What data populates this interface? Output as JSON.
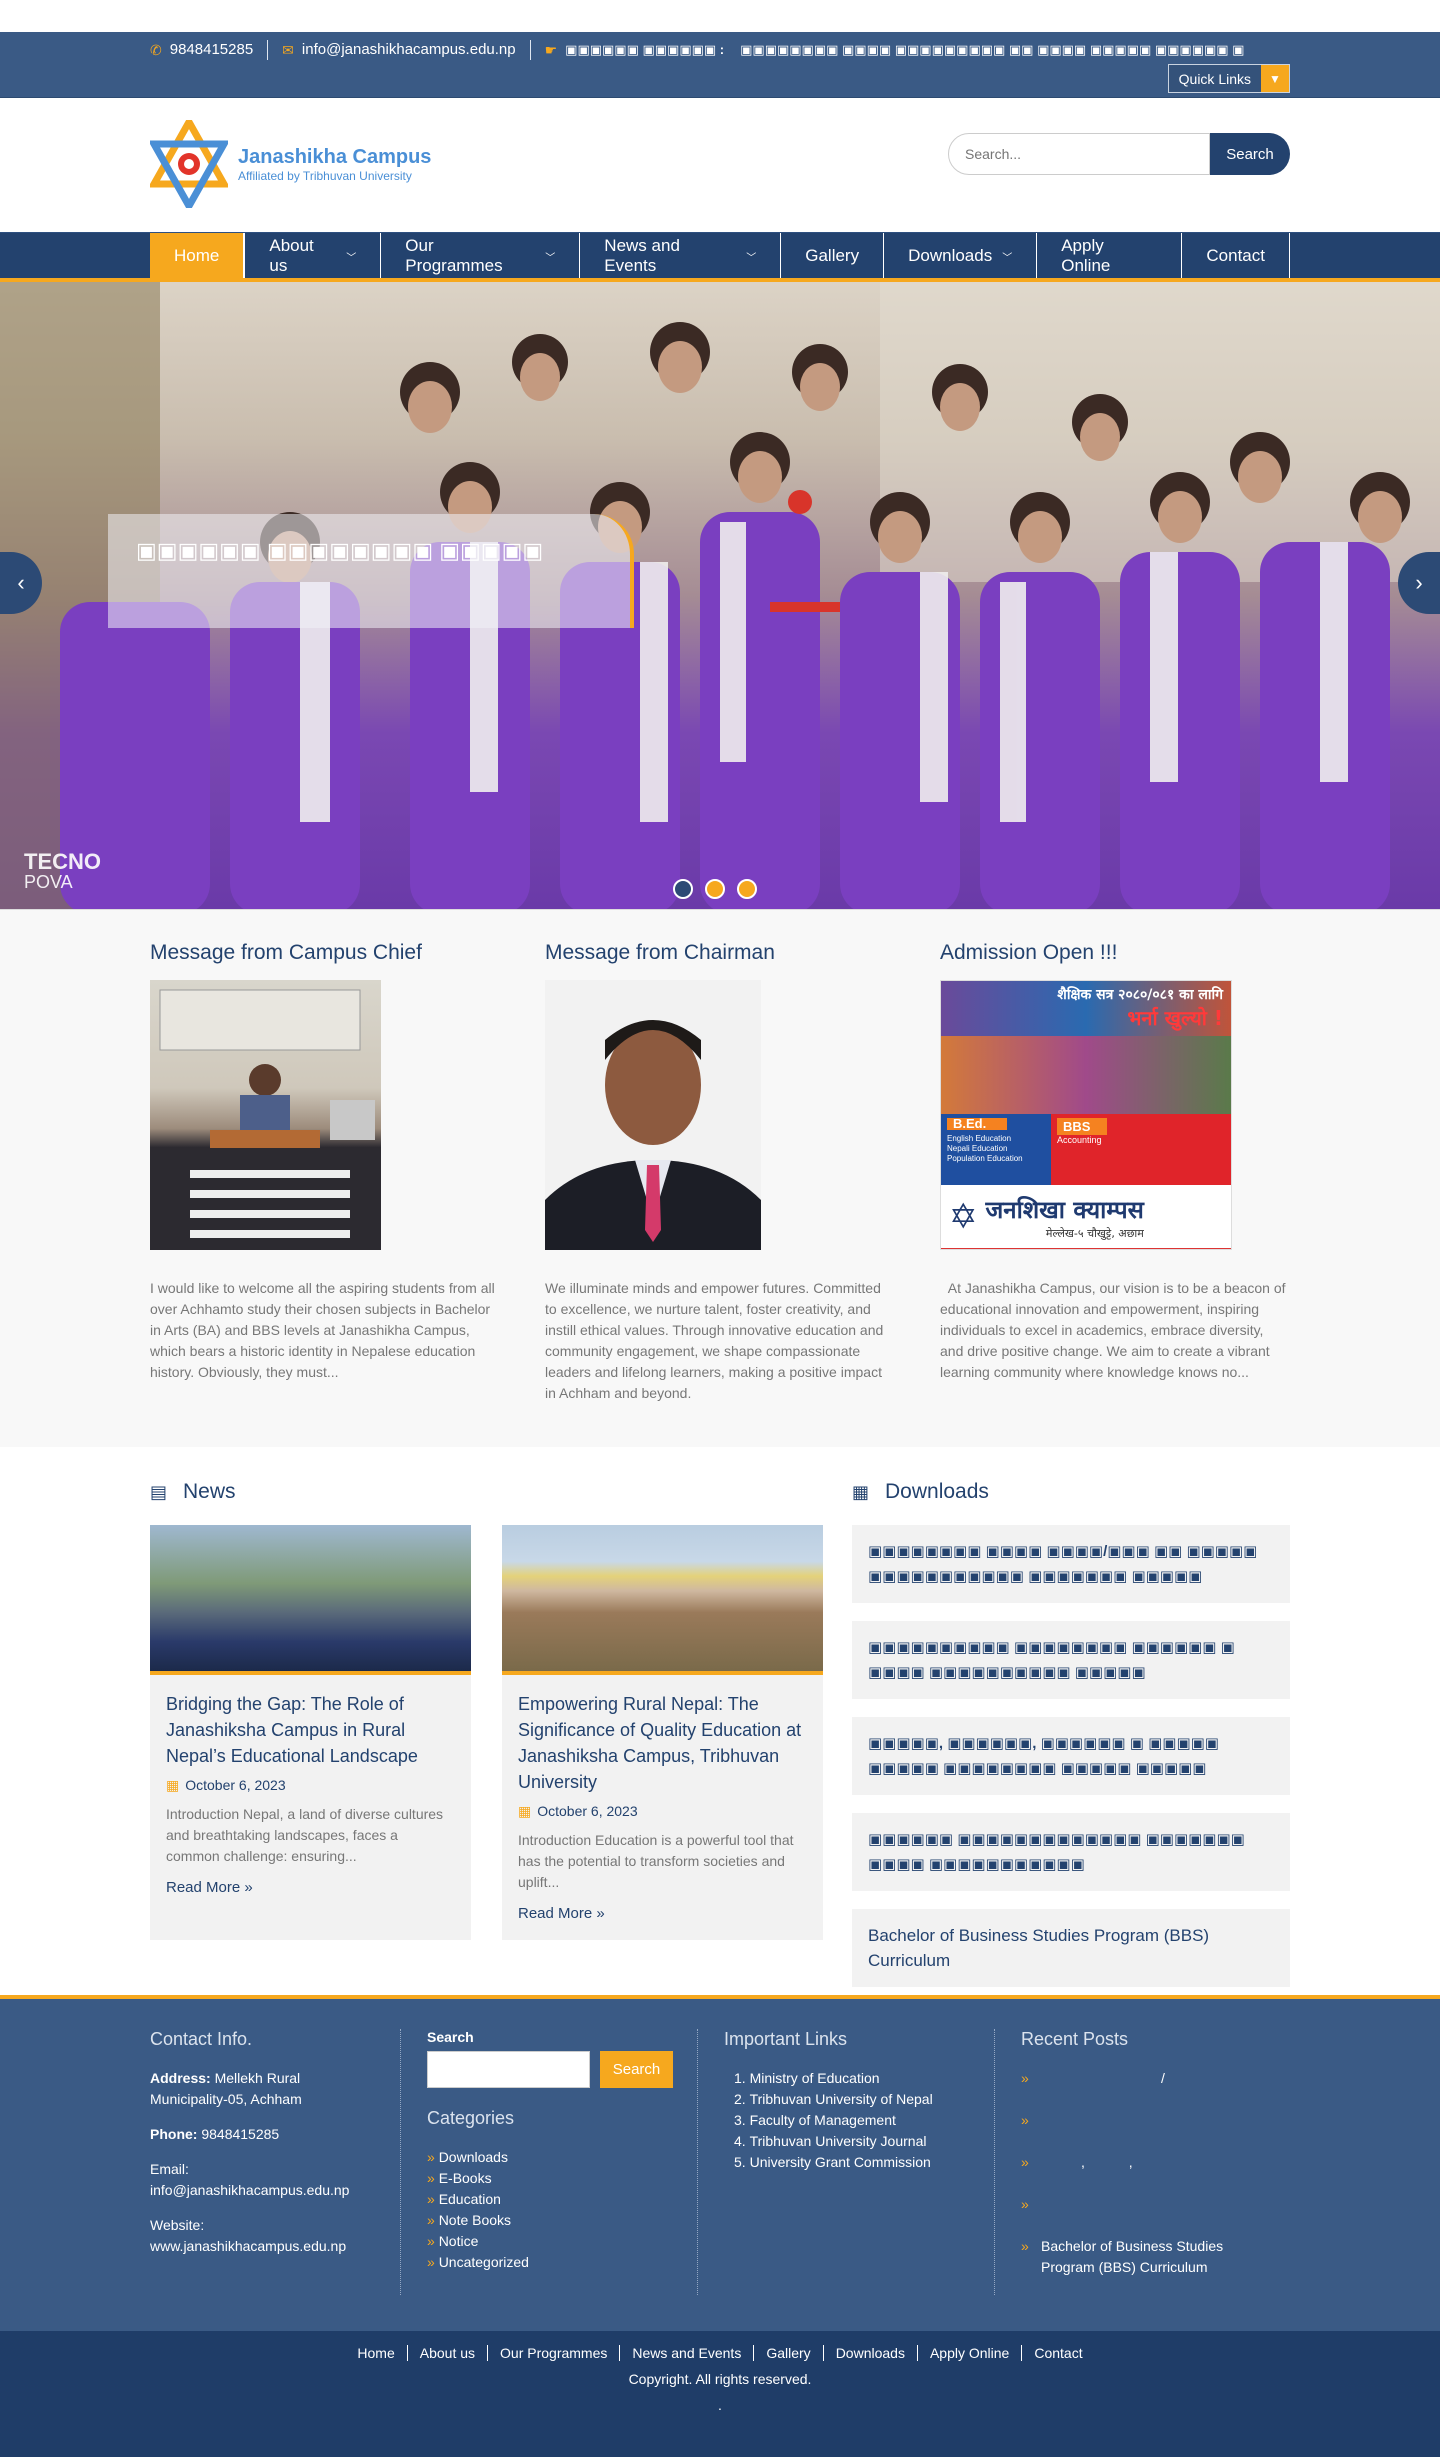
{
  "topbar": {
    "phone": "9848415285",
    "email": "info@janashikhacampus.edu.np",
    "notice_label": "▣▣▣▣▣▣ ▣▣▣▣▣▣ :",
    "notice_text": "▣▣▣▣▣▣▣▣ ▣▣▣▣ ▣▣▣▣▣▣▣▣▣ ▣▣ ▣▣▣▣ ▣▣▣▣▣ ▣▣▣▣▣▣ ▣",
    "quick_links": "Quick Links"
  },
  "header": {
    "logo_name": "Janashikha Campus",
    "logo_sub": "Affiliated by Tribhuvan University",
    "search_placeholder": "Search...",
    "search_button": "Search"
  },
  "nav": {
    "items": [
      {
        "label": "Home"
      },
      {
        "label": "About us"
      },
      {
        "label": "Our Programmes"
      },
      {
        "label": "News and Events"
      },
      {
        "label": "Gallery"
      },
      {
        "label": "Downloads"
      },
      {
        "label": "Apply Online"
      },
      {
        "label": "Contact"
      }
    ]
  },
  "hero": {
    "caption": "▣▣▣▣▣▣ ▣▣▣▣▣▣▣▣ ▣▣▣▣▣",
    "watermark_1": "TECNO",
    "watermark_2": "POVA"
  },
  "messages": [
    {
      "title": "Message from Campus Chief",
      "text": "I would like to welcome all the aspiring students from all over Achhamto study their chosen subjects in Bachelor in Arts (BA) and BBS levels at Janashikha Campus, which bears a historic identity in Nepalese education history. Obviously, they must..."
    },
    {
      "title": "Message from Chairman",
      "text": "We illuminate minds and empower futures. Committed to excellence, we nurture talent, foster creativity, and instill ethical values. Through innovative education and community engagement, we shape compassionate leaders and lifelong learners, making a positive impact in Achham and beyond."
    },
    {
      "title": "Admission Open !!!",
      "text": "  At Janashikha Campus, our vision is to be a beacon of educational innovation and empowerment, inspiring individuals to excel in academics, embrace diversity, and drive positive change. We aim to create a vibrant learning community where knowledge knows no..."
    }
  ],
  "admission_poster": {
    "top": "शैक्षिक सत्र २०८०/०८१ का लागि",
    "open": "भर्ना खुल्यो !",
    "bed": "B.Ed.",
    "bbs": "BBS",
    "bed_sub": "English Education\nNepali Education\nPopulation Education",
    "bbs_sub": "Accounting",
    "campus": "जनशिखा क्याम्पस",
    "address": "मेल्लेख-५ चौखुट्टे, अछाम"
  },
  "news": {
    "title": "News",
    "items": [
      {
        "title": "Bridging the Gap: The Role of Janashiksha Campus in Rural Nepal’s Educational Landscape",
        "date": "October 6, 2023",
        "excerpt": "Introduction Nepal, a land of diverse cultures and breathtaking landscapes, faces a common challenge: ensuring...",
        "more": "Read More"
      },
      {
        "title": "Empowering Rural Nepal: The Significance of Quality Education at Janashiksha Campus, Tribhuvan University",
        "date": "October 6, 2023",
        "excerpt": "Introduction Education is a powerful tool that has the potential to transform societies and uplift...",
        "more": "Read More"
      }
    ]
  },
  "downloads": {
    "title": "Downloads",
    "items": [
      "▣▣▣▣▣▣▣▣ ▣▣▣▣ ▣▣▣▣/▣▣▣ ▣▣ ▣▣▣▣▣ ▣▣▣▣▣▣▣▣▣▣▣ ▣▣▣▣▣▣▣ ▣▣▣▣▣",
      "▣▣▣▣▣▣▣▣▣▣ ▣▣▣▣▣▣▣▣ ▣▣▣▣▣▣ ▣ ▣▣▣▣ ▣▣▣▣▣▣▣▣▣▣ ▣▣▣▣▣",
      "▣▣▣▣▣, ▣▣▣▣▣▣, ▣▣▣▣▣▣ ▣ ▣▣▣▣▣ ▣▣▣▣▣ ▣▣▣▣▣▣▣▣ ▣▣▣▣▣ ▣▣▣▣▣",
      "▣▣▣▣▣▣ ▣▣▣▣▣▣▣▣▣▣▣▣▣ ▣▣▣▣▣▣▣ ▣▣▣▣ ▣▣▣▣▣▣▣▣▣▣▣",
      "Bachelor of Business Studies Program (BBS) Curriculum"
    ]
  },
  "footer": {
    "contact_title": "Contact Info.",
    "address_label": "Address:",
    "address": " Mellekh Rural Municipality-05, Achham",
    "phone_label": "Phone:",
    "phone": " 9848415285",
    "email": "Email: info@janashikhacampus.edu.np",
    "website_label": "Website:",
    "website": "www.janashikhacampus.edu.np",
    "search_label": "Search",
    "search_button": "Search",
    "categories_title": "Categories",
    "categories": [
      "Downloads",
      "E-Books",
      "Education",
      "Note Books",
      "Notice",
      "Uncategorized"
    ],
    "links_title": "Important Links",
    "links": [
      "Ministry of Education",
      "Tribhuvan University of Nepal",
      "Faculty of Management",
      "Tribhuvan University Journal",
      "University Grant Commission"
    ],
    "recent_title": "Recent Posts",
    "recent": [
      "/",
      "",
      ", ,",
      "",
      "Bachelor of Business Studies Program (BBS) Curriculum"
    ]
  },
  "bottom": {
    "links": [
      "Home",
      "About us",
      "Our Programmes",
      "News and Events",
      "Gallery",
      "Downloads",
      "Apply Online",
      "Contact"
    ],
    "copyright": "Copyright. All rights reserved.",
    "dot": "."
  },
  "colors": {
    "navy": "#23426e",
    "orange": "#f6a81e",
    "bar": "#3a5a85"
  }
}
